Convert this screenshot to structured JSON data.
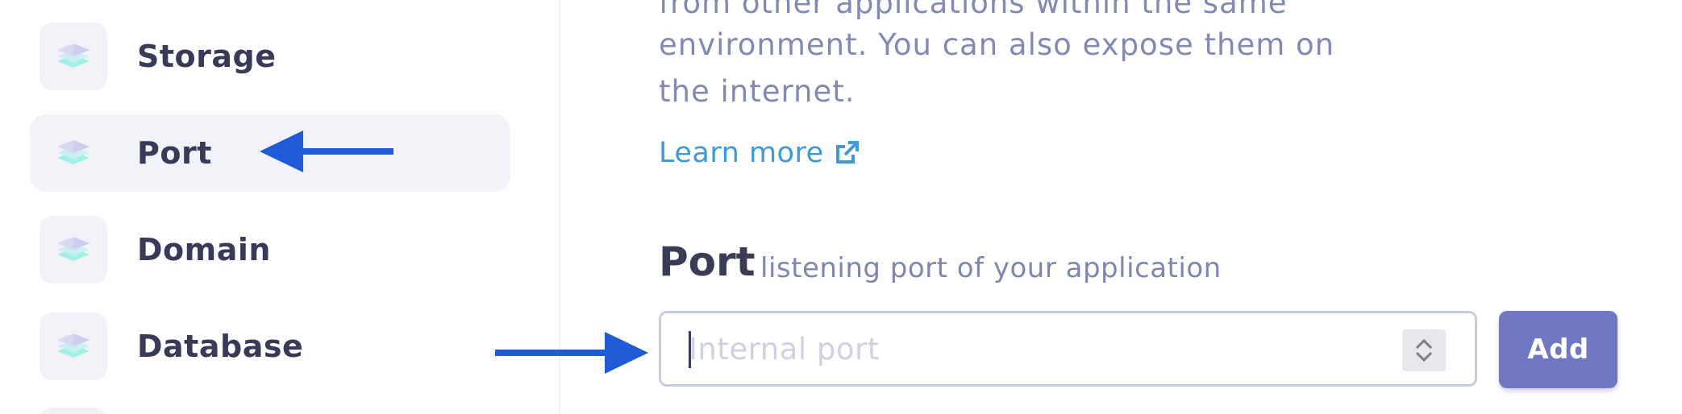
{
  "sidebar": {
    "items": [
      {
        "label": "Storage",
        "icon": "layers-icon",
        "active": false
      },
      {
        "label": "Port",
        "icon": "layers-icon",
        "active": true
      },
      {
        "label": "Domain",
        "icon": "layers-icon",
        "active": false
      },
      {
        "label": "Database",
        "icon": "layers-icon",
        "active": false
      }
    ]
  },
  "main": {
    "description_lines": [
      "from other applications within the same",
      "environment. You can also expose them on",
      "the internet."
    ],
    "learn_more": {
      "label": "Learn more",
      "icon": "external-link-icon"
    },
    "port_section": {
      "title": "Port",
      "subtitle": "listening port of your application",
      "input": {
        "value": "",
        "placeholder": "Internal port"
      },
      "add_button_label": "Add"
    }
  },
  "annotations": {
    "arrow_color": "#1f5bd6"
  },
  "colors": {
    "primary_button": "#7078c4",
    "link": "#3b9ad9",
    "text_primary": "#383a58",
    "text_secondary": "#8389b5",
    "active_item_bg": "#f2f3f8"
  }
}
